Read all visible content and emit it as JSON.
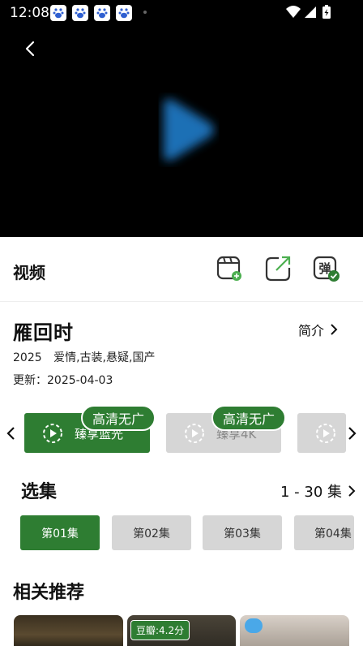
{
  "status_bar": {
    "time": "12:08"
  },
  "toolbar": {
    "title": "视频"
  },
  "info": {
    "title": "雁回时",
    "intro_label": "简介",
    "year": "2025",
    "genres": "爱情,古装,悬疑,国产",
    "update": "更新：2025-04-03"
  },
  "sources": [
    {
      "label": "臻享蓝光",
      "badge": "高清无广",
      "active": true
    },
    {
      "label": "臻享4K",
      "badge": "高清无广",
      "active": false
    }
  ],
  "episodes": {
    "title": "选集",
    "range": "1 - 30 集",
    "items": [
      "第01集",
      "第02集",
      "第03集",
      "第04集"
    ]
  },
  "recommend": {
    "title": "相关推荐",
    "score": "豆瓣:4.2分"
  },
  "colors": {
    "accent": "#2e7d32",
    "inactive": "#d6d6d6"
  }
}
